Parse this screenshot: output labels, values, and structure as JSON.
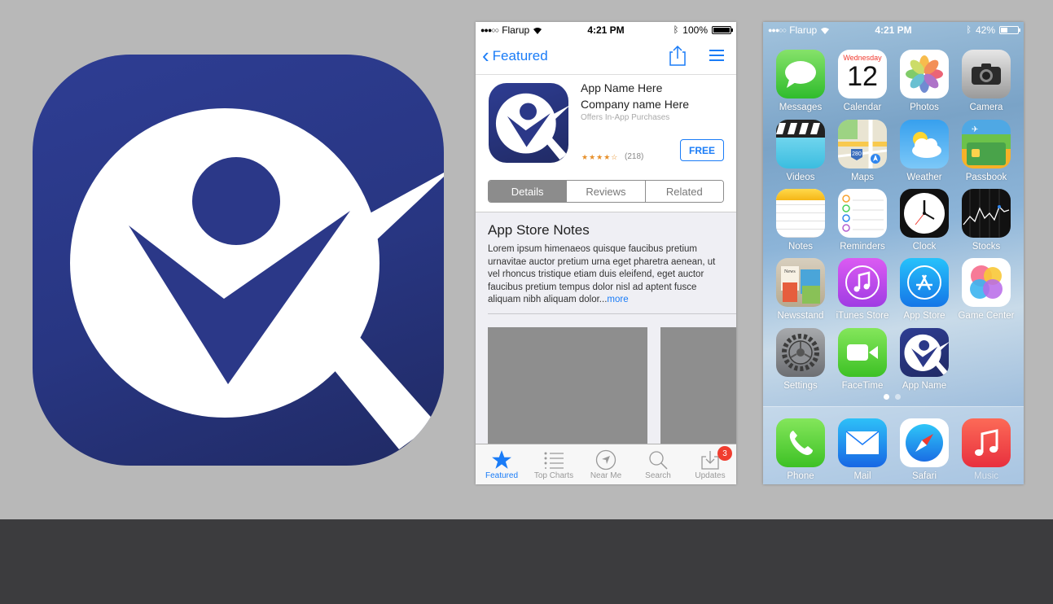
{
  "colors": {
    "brand_navy": "#2b3888",
    "ios_blue": "#1a7cf7",
    "background": "#b8b8b8",
    "footer": "#3c3c3e"
  },
  "app_store": {
    "status": {
      "carrier": "Flarup",
      "time": "4:21 PM",
      "battery": "100%",
      "battery_level": 1.0
    },
    "nav": {
      "back_label": "Featured",
      "icons": [
        "chevron-left-icon",
        "share-icon",
        "menu-icon"
      ]
    },
    "app": {
      "name": "App Name Here",
      "company": "Company name Here",
      "offers": "Offers In-App Purchases",
      "stars": "★★★★☆",
      "rating_value": 4,
      "rating_count": "(218)",
      "price_button": "FREE"
    },
    "segments": [
      {
        "label": "Details",
        "active": true
      },
      {
        "label": "Reviews",
        "active": false
      },
      {
        "label": "Related",
        "active": false
      }
    ],
    "notes": {
      "title": "App Store Notes",
      "body": "Lorem ipsum himenaeos quisque  faucibus pretium urnavitae auctor  pretium urna eget pharetra aenean, ut vel rhoncus tristique etiam duis eleifend, eget auctor faucibus pretium tempus dolor nisl ad aptent fusce aliquam nibh aliquam dolor...",
      "more": "more"
    },
    "tabs": [
      {
        "label": "Featured",
        "icon": "star-icon",
        "active": true
      },
      {
        "label": "Top Charts",
        "icon": "list-icon",
        "active": false
      },
      {
        "label": "Near Me",
        "icon": "compass-icon",
        "active": false
      },
      {
        "label": "Search",
        "icon": "search-icon",
        "active": false
      },
      {
        "label": "Updates",
        "icon": "download-icon",
        "active": false,
        "badge": "3"
      }
    ]
  },
  "home_screen": {
    "status": {
      "carrier": "Flarup",
      "time": "4:21 PM",
      "battery": "42%",
      "battery_level": 0.42
    },
    "calendar": {
      "weekday": "Wednesday",
      "day": "12"
    },
    "apps": [
      {
        "label": "Messages",
        "icon": "messages-icon"
      },
      {
        "label": "Calendar",
        "icon": "calendar-icon"
      },
      {
        "label": "Photos",
        "icon": "photos-icon"
      },
      {
        "label": "Camera",
        "icon": "camera-icon"
      },
      {
        "label": "Videos",
        "icon": "videos-icon"
      },
      {
        "label": "Maps",
        "icon": "maps-icon"
      },
      {
        "label": "Weather",
        "icon": "weather-icon"
      },
      {
        "label": "Passbook",
        "icon": "passbook-icon"
      },
      {
        "label": "Notes",
        "icon": "notes-icon"
      },
      {
        "label": "Reminders",
        "icon": "reminders-icon"
      },
      {
        "label": "Clock",
        "icon": "clock-icon"
      },
      {
        "label": "Stocks",
        "icon": "stocks-icon"
      },
      {
        "label": "Newsstand",
        "icon": "newsstand-icon"
      },
      {
        "label": "iTunes Store",
        "icon": "itunes-store-icon"
      },
      {
        "label": "App Store",
        "icon": "app-store-icon"
      },
      {
        "label": "Game Center",
        "icon": "game-center-icon"
      },
      {
        "label": "Settings",
        "icon": "settings-icon"
      },
      {
        "label": "FaceTime",
        "icon": "facetime-icon"
      },
      {
        "label": "App Name",
        "icon": "app-name-icon"
      }
    ],
    "dock": [
      {
        "label": "Phone",
        "icon": "phone-icon"
      },
      {
        "label": "Mail",
        "icon": "mail-icon"
      },
      {
        "label": "Safari",
        "icon": "safari-icon"
      },
      {
        "label": "Music",
        "icon": "music-icon"
      }
    ],
    "page_dots": {
      "count": 2,
      "active": 1
    },
    "maps_shield": "280",
    "newsstand_label": "News"
  }
}
